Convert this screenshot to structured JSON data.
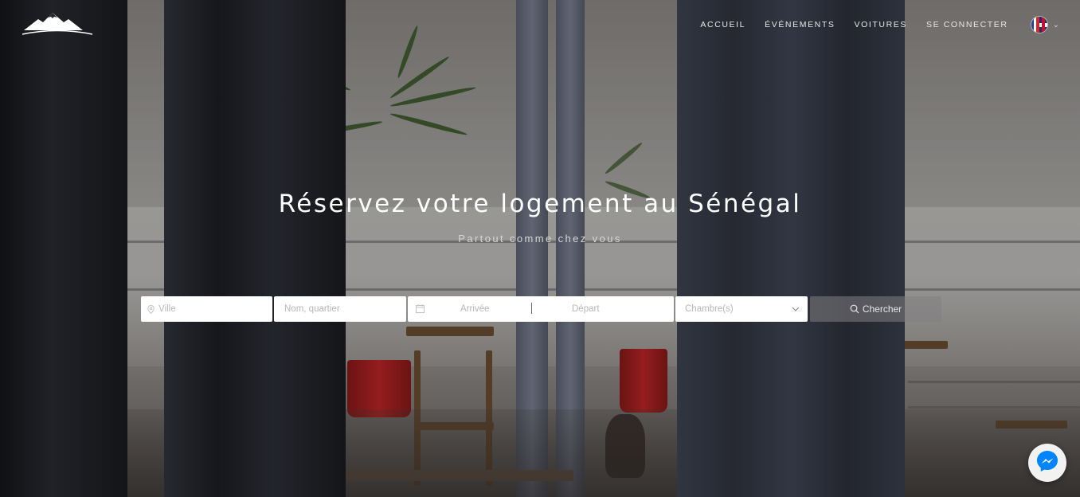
{
  "header": {
    "logo_icon": "mountain-logo-icon",
    "nav": [
      {
        "label": "ACCUEIL"
      },
      {
        "label": "ÉVÉNEMENTS"
      },
      {
        "label": "VOITURES"
      },
      {
        "label": "SE CONNECTER"
      }
    ],
    "language": {
      "flag_icon": "fr-uk-flag-icon",
      "dropdown_icon": "chevron-down-icon"
    }
  },
  "hero": {
    "title": "Réservez votre logement au Sénégal",
    "subtitle": "Partout comme chez vous"
  },
  "search": {
    "ville_placeholder": "Ville",
    "nom_placeholder": "Nom, quartier",
    "arrivee_placeholder": "Arrivée",
    "depart_placeholder": "Départ",
    "chambres_label": "Chambre(s)",
    "button_label": "Chercher",
    "icons": {
      "ville": "map-pin-icon",
      "dates": "calendar-icon",
      "button": "search-icon"
    }
  },
  "chat": {
    "icon": "messenger-icon"
  },
  "colors": {
    "text_light": "#ffffff",
    "field_bg": "#ffffff",
    "placeholder": "#b8b8b8",
    "button_bg": "#828082",
    "messenger_blue": "#0084ff"
  }
}
